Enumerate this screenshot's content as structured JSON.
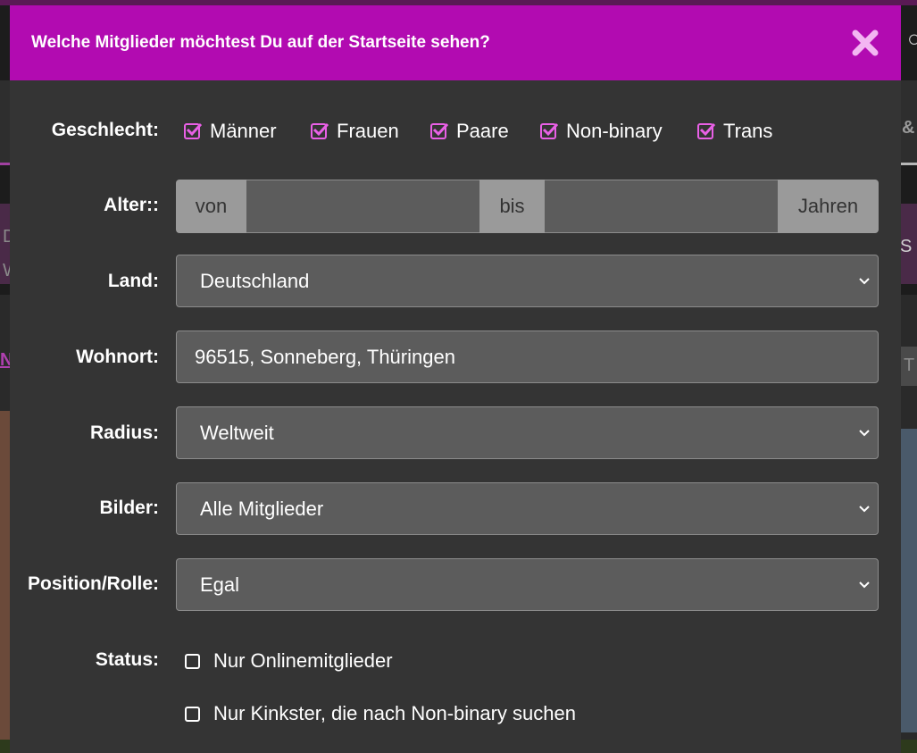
{
  "dialog": {
    "title": "Welche Mitglieder möchtest Du auf der Startseite sehen?"
  },
  "background": {
    "right_amp": "&",
    "left_d": "D",
    "left_w": "W",
    "left_n": "N",
    "right_t": "T",
    "right_s": "S"
  },
  "gender": {
    "label": "Geschlecht:",
    "options": [
      {
        "label": "Männer",
        "checked": true
      },
      {
        "label": "Frauen",
        "checked": true
      },
      {
        "label": "Paare",
        "checked": true
      },
      {
        "label": "Non-binary",
        "checked": true
      },
      {
        "label": "Trans",
        "checked": true
      }
    ]
  },
  "age": {
    "label": "Alter::",
    "from_addon": "von",
    "from_value": "",
    "to_addon": "bis",
    "to_value": "",
    "unit_addon": "Jahren"
  },
  "country": {
    "label": "Land:",
    "selected": "Deutschland"
  },
  "residence": {
    "label": "Wohnort:",
    "value": "96515, Sonneberg, Thüringen"
  },
  "radius": {
    "label": "Radius:",
    "selected": "Weltweit"
  },
  "pictures": {
    "label": "Bilder:",
    "selected": "Alle Mitglieder"
  },
  "position": {
    "label": "Position/Rolle:",
    "selected": "Egal"
  },
  "status": {
    "label": "Status:",
    "options": [
      {
        "label": "Nur Onlinemitglieder",
        "checked": false
      },
      {
        "label": "Nur Kinkster, die nach Non-binary suchen",
        "checked": false
      }
    ]
  },
  "colors": {
    "header": "#b20bb1",
    "checkbox_accent": "#e960e6",
    "modal_bg": "#343434",
    "field_bg": "#5c5c5c",
    "addon_bg": "#9a9a9a"
  }
}
